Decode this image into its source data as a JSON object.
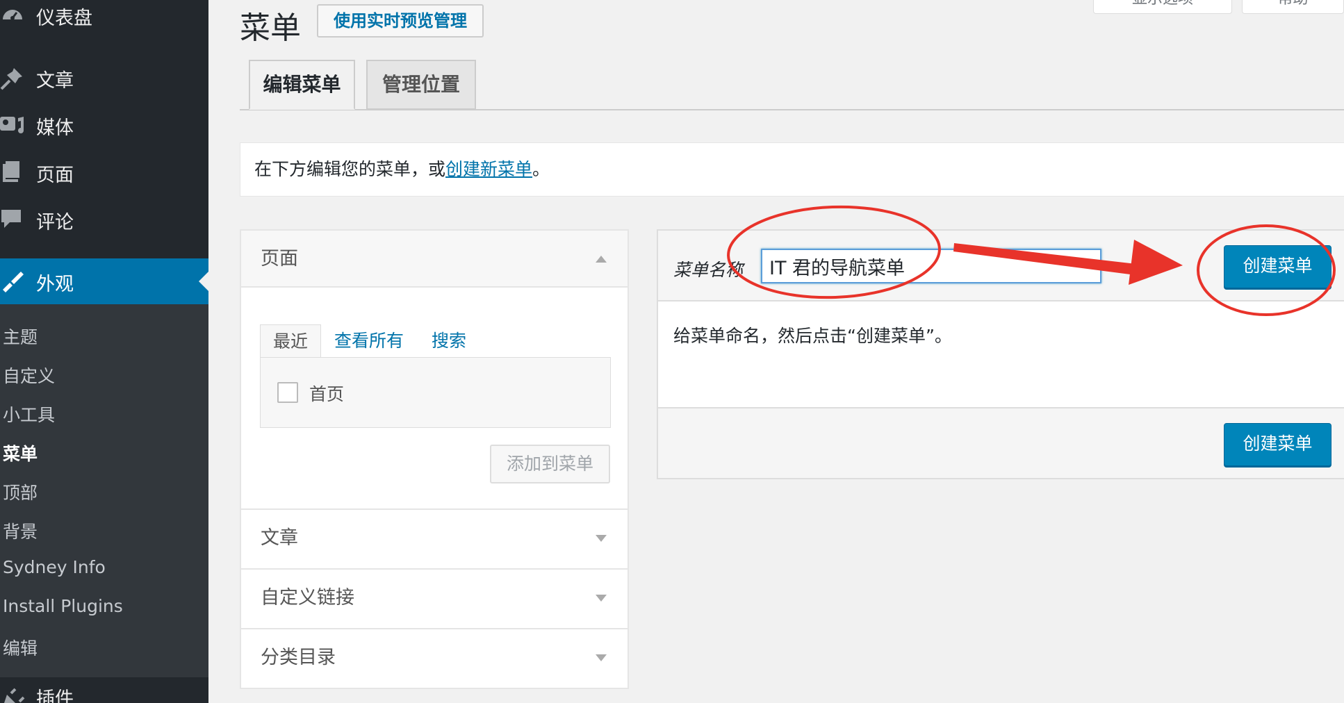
{
  "sidebar": {
    "items": [
      {
        "label": "仪表盘",
        "icon": "dashboard-icon"
      },
      {
        "label": "文章",
        "icon": "pushpin-icon"
      },
      {
        "label": "媒体",
        "icon": "media-icon"
      },
      {
        "label": "页面",
        "icon": "pages-icon"
      },
      {
        "label": "评论",
        "icon": "comments-icon"
      },
      {
        "label": "外观",
        "icon": "appearance-brush-icon",
        "active": true
      },
      {
        "label": "插件",
        "icon": "plugins-icon"
      }
    ],
    "submenu": [
      "主题",
      "自定义",
      "小工具",
      "菜单",
      "顶部",
      "背景",
      "Sydney Info",
      "Install Plugins",
      "编辑"
    ],
    "current_submenu": "菜单",
    "active_color": "#0073aa",
    "bg_color": "#23282d"
  },
  "header": {
    "title": "菜单",
    "preview_button": "使用实时预览管理",
    "screen_options": "显示选项",
    "help": "帮助"
  },
  "tabs": [
    {
      "label": "编辑菜单",
      "active": true
    },
    {
      "label": "管理位置",
      "active": false
    }
  ],
  "notice": {
    "text_before": "在下方编辑您的菜单，或",
    "link": "创建新菜单",
    "text_after": "。"
  },
  "accordion": {
    "pages": {
      "title": "页面",
      "tabs": [
        "最近",
        "查看所有",
        "搜索"
      ],
      "items": [
        "首页"
      ],
      "add_button": "添加到菜单"
    },
    "sections": [
      "文章",
      "自定义链接",
      "分类目录"
    ]
  },
  "menu_editor": {
    "name_label": "菜单名称",
    "name_value": "IT 君的导航菜单",
    "create_button": "创建菜单",
    "hint": "给菜单命名，然后点击“创建菜单”。",
    "create_button_bottom": "创建菜单"
  },
  "annotation_color": "#e8332a",
  "primary_color": "#0085ba"
}
